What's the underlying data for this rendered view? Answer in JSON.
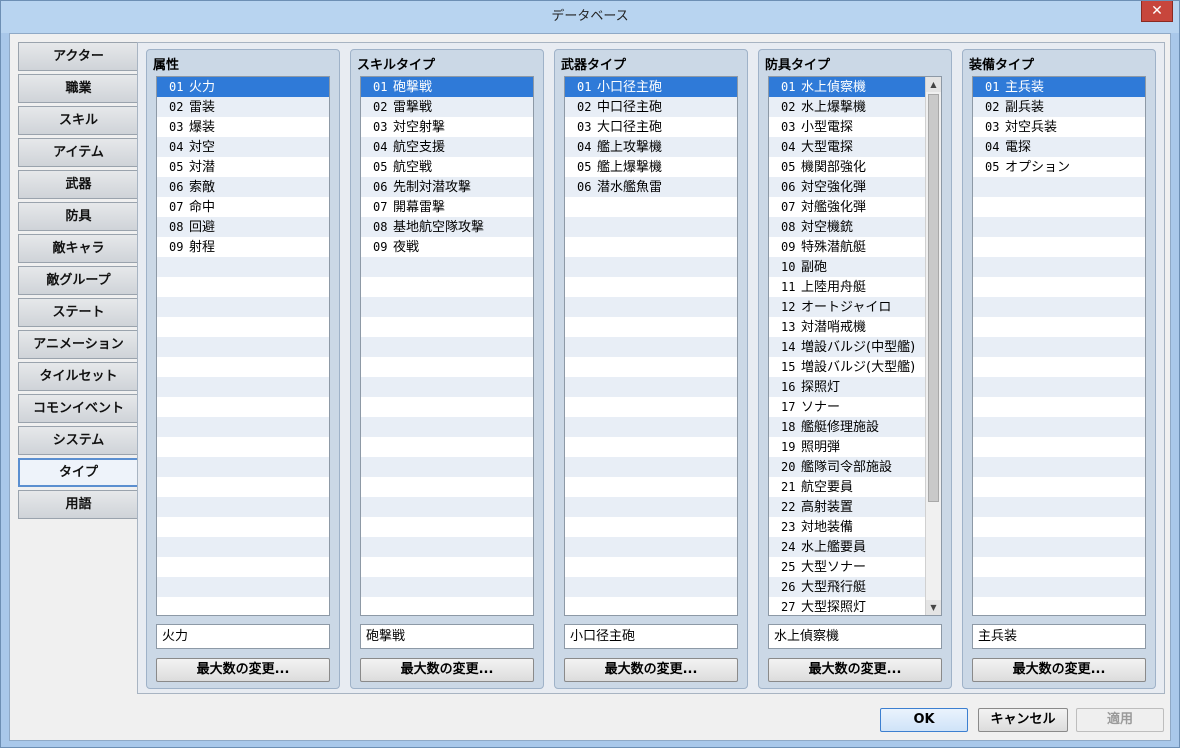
{
  "window": {
    "title": "データベース",
    "close_label": "✕"
  },
  "nav": {
    "items": [
      {
        "label": "アクター"
      },
      {
        "label": "職業"
      },
      {
        "label": "スキル"
      },
      {
        "label": "アイテム"
      },
      {
        "label": "武器"
      },
      {
        "label": "防具"
      },
      {
        "label": "敵キャラ"
      },
      {
        "label": "敵グループ"
      },
      {
        "label": "ステート"
      },
      {
        "label": "アニメーション"
      },
      {
        "label": "タイルセット"
      },
      {
        "label": "コモンイベント"
      },
      {
        "label": "システム"
      },
      {
        "label": "タイプ"
      },
      {
        "label": "用語"
      }
    ],
    "selected_index": 13
  },
  "panels": [
    {
      "title": "属性",
      "selected_index": 0,
      "items": [
        {
          "num": "01",
          "label": "火力"
        },
        {
          "num": "02",
          "label": "雷装"
        },
        {
          "num": "03",
          "label": "爆装"
        },
        {
          "num": "04",
          "label": "対空"
        },
        {
          "num": "05",
          "label": "対潜"
        },
        {
          "num": "06",
          "label": "索敵"
        },
        {
          "num": "07",
          "label": "命中"
        },
        {
          "num": "08",
          "label": "回避"
        },
        {
          "num": "09",
          "label": "射程"
        }
      ],
      "name_value": "火力",
      "max_button": "最大数の変更..."
    },
    {
      "title": "スキルタイプ",
      "selected_index": 0,
      "items": [
        {
          "num": "01",
          "label": "砲撃戦"
        },
        {
          "num": "02",
          "label": "雷撃戦"
        },
        {
          "num": "03",
          "label": "対空射撃"
        },
        {
          "num": "04",
          "label": "航空支援"
        },
        {
          "num": "05",
          "label": "航空戦"
        },
        {
          "num": "06",
          "label": "先制対潜攻撃"
        },
        {
          "num": "07",
          "label": "開幕雷撃"
        },
        {
          "num": "08",
          "label": "基地航空隊攻撃"
        },
        {
          "num": "09",
          "label": "夜戦"
        }
      ],
      "name_value": "砲撃戦",
      "max_button": "最大数の変更..."
    },
    {
      "title": "武器タイプ",
      "selected_index": 0,
      "items": [
        {
          "num": "01",
          "label": "小口径主砲"
        },
        {
          "num": "02",
          "label": "中口径主砲"
        },
        {
          "num": "03",
          "label": "大口径主砲"
        },
        {
          "num": "04",
          "label": "艦上攻撃機"
        },
        {
          "num": "05",
          "label": "艦上爆撃機"
        },
        {
          "num": "06",
          "label": "潜水艦魚雷"
        }
      ],
      "name_value": "小口径主砲",
      "max_button": "最大数の変更..."
    },
    {
      "title": "防具タイプ",
      "selected_index": 0,
      "has_scrollbar": true,
      "items": [
        {
          "num": "01",
          "label": "水上偵察機"
        },
        {
          "num": "02",
          "label": "水上爆撃機"
        },
        {
          "num": "03",
          "label": "小型電探"
        },
        {
          "num": "04",
          "label": "大型電探"
        },
        {
          "num": "05",
          "label": "機関部強化"
        },
        {
          "num": "06",
          "label": "対空強化弾"
        },
        {
          "num": "07",
          "label": "対艦強化弾"
        },
        {
          "num": "08",
          "label": "対空機銃"
        },
        {
          "num": "09",
          "label": "特殊潜航艇"
        },
        {
          "num": "10",
          "label": "副砲"
        },
        {
          "num": "11",
          "label": "上陸用舟艇"
        },
        {
          "num": "12",
          "label": "オートジャイロ"
        },
        {
          "num": "13",
          "label": "対潜哨戒機"
        },
        {
          "num": "14",
          "label": "増設バルジ(中型艦)"
        },
        {
          "num": "15",
          "label": "増設バルジ(大型艦)"
        },
        {
          "num": "16",
          "label": "探照灯"
        },
        {
          "num": "17",
          "label": "ソナー"
        },
        {
          "num": "18",
          "label": "艦艇修理施設"
        },
        {
          "num": "19",
          "label": "照明弾"
        },
        {
          "num": "20",
          "label": "艦隊司令部施設"
        },
        {
          "num": "21",
          "label": "航空要員"
        },
        {
          "num": "22",
          "label": "高射装置"
        },
        {
          "num": "23",
          "label": "対地装備"
        },
        {
          "num": "24",
          "label": "水上艦要員"
        },
        {
          "num": "25",
          "label": "大型ソナー"
        },
        {
          "num": "26",
          "label": "大型飛行艇"
        },
        {
          "num": "27",
          "label": "大型探照灯"
        }
      ],
      "name_value": "水上偵察機",
      "max_button": "最大数の変更..."
    },
    {
      "title": "装備タイプ",
      "selected_index": 0,
      "items": [
        {
          "num": "01",
          "label": "主兵装"
        },
        {
          "num": "02",
          "label": "副兵装"
        },
        {
          "num": "03",
          "label": "対空兵装"
        },
        {
          "num": "04",
          "label": "電探"
        },
        {
          "num": "05",
          "label": "オプション"
        }
      ],
      "name_value": "主兵装",
      "max_button": "最大数の変更..."
    }
  ],
  "buttons": {
    "ok": "OK",
    "cancel": "キャンセル",
    "apply": "適用"
  },
  "colors": {
    "selection": "#2f7ad8",
    "title_bar": "#b8d4f0",
    "close": "#c7463c"
  },
  "scroll_icons": {
    "up": "scroll-up-arrow-icon",
    "down": "scroll-down-arrow-icon"
  }
}
